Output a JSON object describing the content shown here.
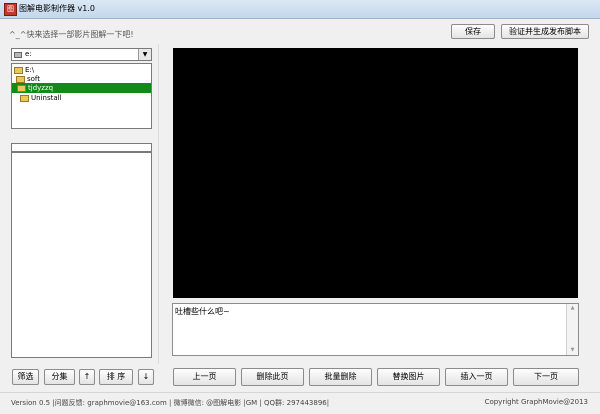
{
  "window": {
    "title": "图解电影制作器 v1.0",
    "icon": "app-icon"
  },
  "header": {
    "hint": "^_^快来选择一部影片图解一下吧!",
    "save_label": "保存",
    "verify_label": "验证并生成发布脚本"
  },
  "sidebar": {
    "drive_value": "e:",
    "tree": [
      "E:\\",
      "soft",
      "tjdyzzq",
      "Uninstall"
    ],
    "selected_index": 2,
    "path_value": "",
    "buttons": {
      "filter": "筛选",
      "group": "分集",
      "up": "↑",
      "sort": "排 序",
      "down": "↓"
    }
  },
  "editor": {
    "comment_text": "吐槽些什么吧~"
  },
  "toolbar": {
    "prev": "上一页",
    "delete_page": "删除此页",
    "batch_delete": "批量删除",
    "replace_image": "替换图片",
    "insert_page": "插入一页",
    "next": "下一页"
  },
  "status": {
    "left": "Version 0.5 |问题反馈: graphmovie@163.com | 微博微信: @图解电影 |GM | QQ群: 297443896|",
    "right": "Copyright GraphMovie@2013"
  }
}
